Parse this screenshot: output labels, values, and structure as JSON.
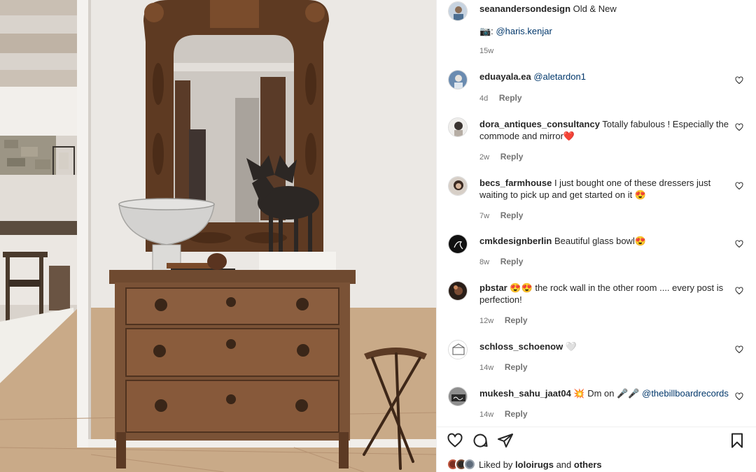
{
  "post": {
    "author": "seanandersondesign",
    "caption": "Old & New",
    "credit_emoji": "📷:",
    "credit_handle": "@haris.kenjar",
    "age": "15w"
  },
  "comments": [
    {
      "user": "eduayala.ea",
      "pre": "",
      "mention": "@aletardon1",
      "post": "",
      "age": "4d",
      "reply": "Reply"
    },
    {
      "user": "dora_antiques_consultancy",
      "pre": "Totally fabulous ! Especially the commode and mirror❤️",
      "mention": "",
      "post": "",
      "age": "2w",
      "reply": "Reply"
    },
    {
      "user": "becs_farmhouse",
      "pre": "I just bought one of these dressers just waiting to pick up and get started on it 😍",
      "mention": "",
      "post": "",
      "age": "7w",
      "reply": "Reply"
    },
    {
      "user": "cmkdesignberlin",
      "pre": "Beautiful glass bowl😍",
      "mention": "",
      "post": "",
      "age": "8w",
      "reply": "Reply"
    },
    {
      "user": "pbstar",
      "pre": "😍😍 the rock wall in the other room .... every post is perfection!",
      "mention": "",
      "post": "",
      "age": "12w",
      "reply": "Reply"
    },
    {
      "user": "schloss_schoenow",
      "pre": "🤍",
      "mention": "",
      "post": "",
      "age": "14w",
      "reply": "Reply"
    },
    {
      "user": "mukesh_sahu_jaat04",
      "pre": "💥 Dm on 🎤🎤",
      "mention": "@thebillboardrecords",
      "post": "",
      "age": "14w",
      "reply": "Reply"
    }
  ],
  "likes": {
    "prefix": "Liked by",
    "user": "loloirugs",
    "joiner": "and",
    "others": "others"
  },
  "colors": {
    "link": "#00376b",
    "muted": "#737373",
    "text": "#262626"
  },
  "icons": [
    "heart-icon",
    "comment-icon",
    "share-icon",
    "bookmark-icon"
  ]
}
